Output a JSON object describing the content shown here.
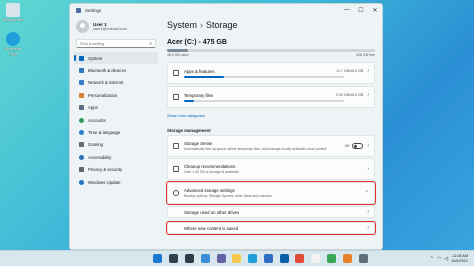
{
  "desktop": {
    "icons": [
      {
        "label": "Recycle Bin",
        "color": "#d9e3ea"
      },
      {
        "label": "Microsoft Edge",
        "color": "#1f9fd9"
      }
    ]
  },
  "window": {
    "title": "Settings",
    "controls": [
      "—",
      "☐",
      "✕"
    ]
  },
  "user": {
    "name": "User 1",
    "email": "user1@hotmail.com"
  },
  "search": {
    "placeholder": "Find a setting"
  },
  "nav": [
    {
      "label": "System",
      "color": "#0067c0",
      "active": true
    },
    {
      "label": "Bluetooth & devices",
      "color": "#2b79c2"
    },
    {
      "label": "Network & internet",
      "color": "#3a7cc7"
    },
    {
      "label": "Personalization",
      "color": "#d9812c"
    },
    {
      "label": "Apps",
      "color": "#5a6e84"
    },
    {
      "label": "Accounts",
      "color": "#2f9a5d"
    },
    {
      "label": "Time & language",
      "color": "#2a7fc8"
    },
    {
      "label": "Gaming",
      "color": "#6b6b6b"
    },
    {
      "label": "Accessibility",
      "color": "#2a6fb8"
    },
    {
      "label": "Privacy & security",
      "color": "#5b6470"
    },
    {
      "label": "Windows Update",
      "color": "#1d72c9"
    }
  ],
  "content": {
    "breadcrumb_parent": "System",
    "breadcrumb_sep": "›",
    "breadcrumb_current": "Storage",
    "drive_title": "Acer (C:) - 475 GB",
    "drive_used": "46.5 GB used",
    "drive_free": "428 GB free",
    "drive_used_fraction": 0.1,
    "usage": [
      {
        "label": "Apps & features",
        "value": "11.7 GB/46.5 GB",
        "fraction": 0.25
      },
      {
        "label": "Temporary files",
        "value": "2.90 GB/46.5 GB",
        "fraction": 0.06
      }
    ],
    "show_more": "Show more categories",
    "section_label": "Storage management",
    "storage_sense": {
      "title": "Storage Sense",
      "subtitle": "Automatically free up space, delete temporary files, and manage locally available cloud content",
      "state": "Off"
    },
    "cleanup": {
      "title": "Cleanup recommendations",
      "subtitle": "Over 1.00 GB of storage is available."
    },
    "advanced": {
      "title": "Advanced storage settings",
      "subtitle": "Backup options, Storage Spaces, other disks and volumes",
      "chevron": "⌃"
    },
    "sub_items": [
      "Storage used on other drives",
      "Where new content is saved"
    ],
    "chevron": "›"
  },
  "taskbar": {
    "icons": [
      {
        "name": "start",
        "color": "#1f78d1"
      },
      {
        "name": "search",
        "color": "#30404e"
      },
      {
        "name": "task-view",
        "color": "#2f3b46"
      },
      {
        "name": "widgets",
        "color": "#3c8fd6"
      },
      {
        "name": "chat",
        "color": "#6264a7"
      },
      {
        "name": "file-explorer",
        "color": "#f2c94c"
      },
      {
        "name": "edge",
        "color": "#1fa0d8"
      },
      {
        "name": "store",
        "color": "#2d6ec4"
      },
      {
        "name": "app-blue",
        "color": "#0a5fa8"
      },
      {
        "name": "app-red",
        "color": "#e04a3a"
      },
      {
        "name": "app-white",
        "color": "#f2f2f2"
      },
      {
        "name": "app-green",
        "color": "#3aa657"
      },
      {
        "name": "app-orange",
        "color": "#e8832b"
      },
      {
        "name": "settings",
        "color": "#5f6e7b"
      }
    ],
    "time": "11:08 AM",
    "date": "10/4/2021"
  }
}
